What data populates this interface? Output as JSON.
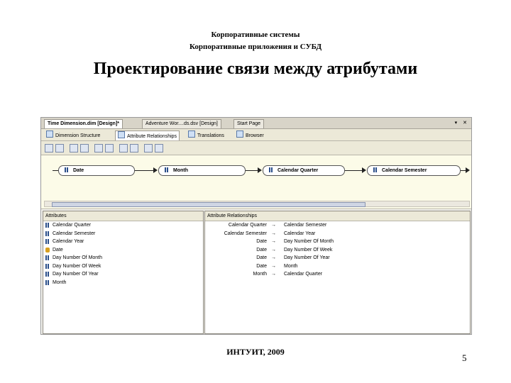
{
  "slide": {
    "header_line1": "Корпоративные системы",
    "header_line2": "Корпоративные приложения и СУБД",
    "title": "Проектирование связи между атрибутами",
    "footer": "ИНТУИТ, 2009",
    "page_number": "5"
  },
  "window": {
    "doc_tabs": [
      "Time Dimension.dim [Design]*",
      "Adventure Wor....ds.dsv [Design]",
      "Start Page"
    ],
    "doc_controls": "▾ ✕",
    "sub_tabs": [
      "Dimension Structure",
      "Attribute Relationships",
      "Translations",
      "Browser"
    ],
    "diagram_nodes": [
      "Date",
      "Month",
      "Calendar Quarter",
      "Calendar Semester"
    ],
    "attributes_header": "Attributes",
    "attributes": [
      {
        "name": "Calendar Quarter",
        "icon": "attribute-icon"
      },
      {
        "name": "Calendar Semester",
        "icon": "attribute-icon"
      },
      {
        "name": "Calendar Year",
        "icon": "attribute-icon"
      },
      {
        "name": "Date",
        "icon": "key-attribute-icon"
      },
      {
        "name": "Day Number Of Month",
        "icon": "attribute-icon"
      },
      {
        "name": "Day Number Of Week",
        "icon": "attribute-icon"
      },
      {
        "name": "Day Number Of Year",
        "icon": "attribute-icon"
      },
      {
        "name": "Month",
        "icon": "attribute-icon"
      }
    ],
    "relationships_header": "Attribute Relationships",
    "arrow_glyph": "→",
    "relationships": [
      {
        "source": "Calendar Quarter",
        "target": "Calendar Semester"
      },
      {
        "source": "Calendar Semester",
        "target": "Calendar Year"
      },
      {
        "source": "Date",
        "target": "Day Number Of Month"
      },
      {
        "source": "Date",
        "target": "Day Number Of Week"
      },
      {
        "source": "Date",
        "target": "Day Number Of Year"
      },
      {
        "source": "Date",
        "target": "Month"
      },
      {
        "source": "Month",
        "target": "Calendar Quarter"
      }
    ]
  }
}
